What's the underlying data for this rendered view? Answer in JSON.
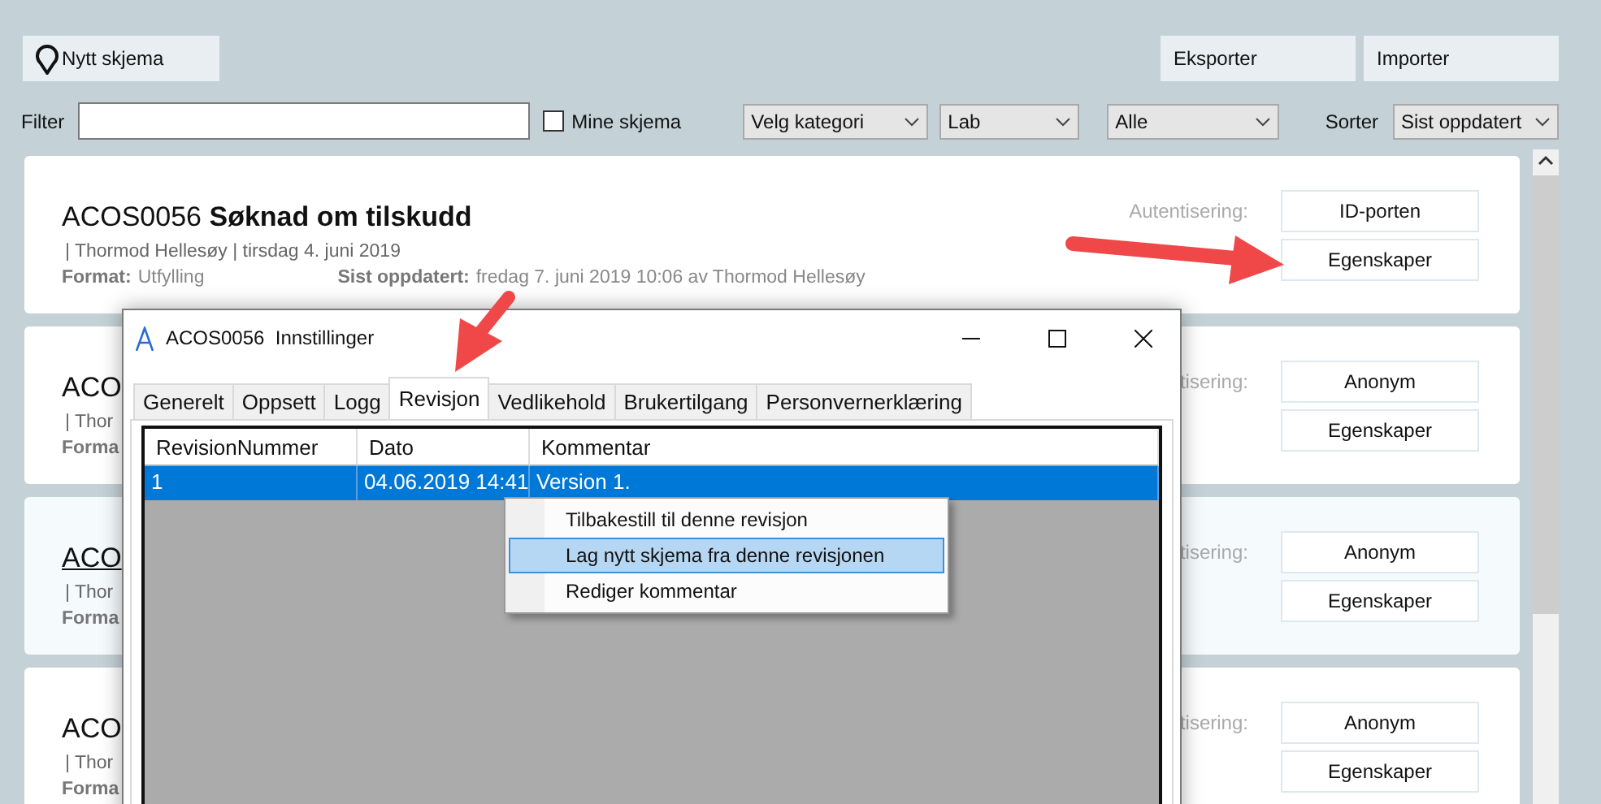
{
  "toolbar": {
    "new_button": "Nytt skjema",
    "export_button": "Eksporter",
    "import_button": "Importer"
  },
  "filter": {
    "label": "Filter",
    "mine": {
      "label": "Mine skjema",
      "checked": false
    },
    "dropdowns": [
      "Velg kategori",
      "Lab",
      "Alle"
    ],
    "sort_label": "Sorter",
    "sort_value": "Sist oppdatert"
  },
  "cards": [
    {
      "kind": "full",
      "hovered": false,
      "code": "ACOS0056",
      "title": "Søknad om tilskudd",
      "meta": "| Thormod Hellesøy | tirsdag 4. juni 2019",
      "format_label": "Format:",
      "format_value": "Utfylling",
      "updated_label": "Sist oppdatert:",
      "updated_value": "fredag 7. juni 2019 10:06 av Thormod Hellesøy",
      "auth_label": "Autentisering:",
      "auth_button": "ID-porten",
      "props_button": "Egenskaper"
    },
    {
      "kind": "covered",
      "hovered": false,
      "code": "ACO",
      "meta": "| Thor",
      "format_label": "Forma",
      "auth_label": "tisering:",
      "auth_button": "Anonym",
      "props_button": "Egenskaper"
    },
    {
      "kind": "covered",
      "hovered": true,
      "code": "ACO",
      "meta": "| Thor",
      "format_label": "Forma",
      "auth_label": "tisering:",
      "auth_button": "Anonym",
      "props_button": "Egenskaper"
    },
    {
      "kind": "covered",
      "hovered": false,
      "code": "ACO",
      "meta": "| Thor",
      "format_label": "Forma",
      "auth_label": "tisering:",
      "auth_button": "Anonym",
      "props_button": "Egenskaper"
    }
  ],
  "dialog": {
    "title": "ACOS0056  Innstillinger",
    "tabs": [
      {
        "label": "Generelt",
        "selected": false
      },
      {
        "label": "Oppsett",
        "selected": false
      },
      {
        "label": "Logg",
        "selected": false
      },
      {
        "label": "Revisjon",
        "selected": true
      },
      {
        "label": "Vedlikehold",
        "selected": false
      },
      {
        "label": "Brukertilgang",
        "selected": false
      },
      {
        "label": "Personvernerklæring",
        "selected": false
      }
    ],
    "table": {
      "columns": [
        "RevisionNummer",
        "Dato",
        "Kommentar"
      ],
      "rows": [
        {
          "cells": [
            "1",
            "04.06.2019 14:41",
            "Version 1."
          ],
          "selected": true
        }
      ]
    },
    "context_menu": [
      {
        "label": "Tilbakestill til denne revisjon",
        "selected": false
      },
      {
        "label": "Lag nytt skjema fra denne revisjonen",
        "selected": true
      },
      {
        "label": "Rediger kommentar",
        "selected": false
      }
    ]
  }
}
